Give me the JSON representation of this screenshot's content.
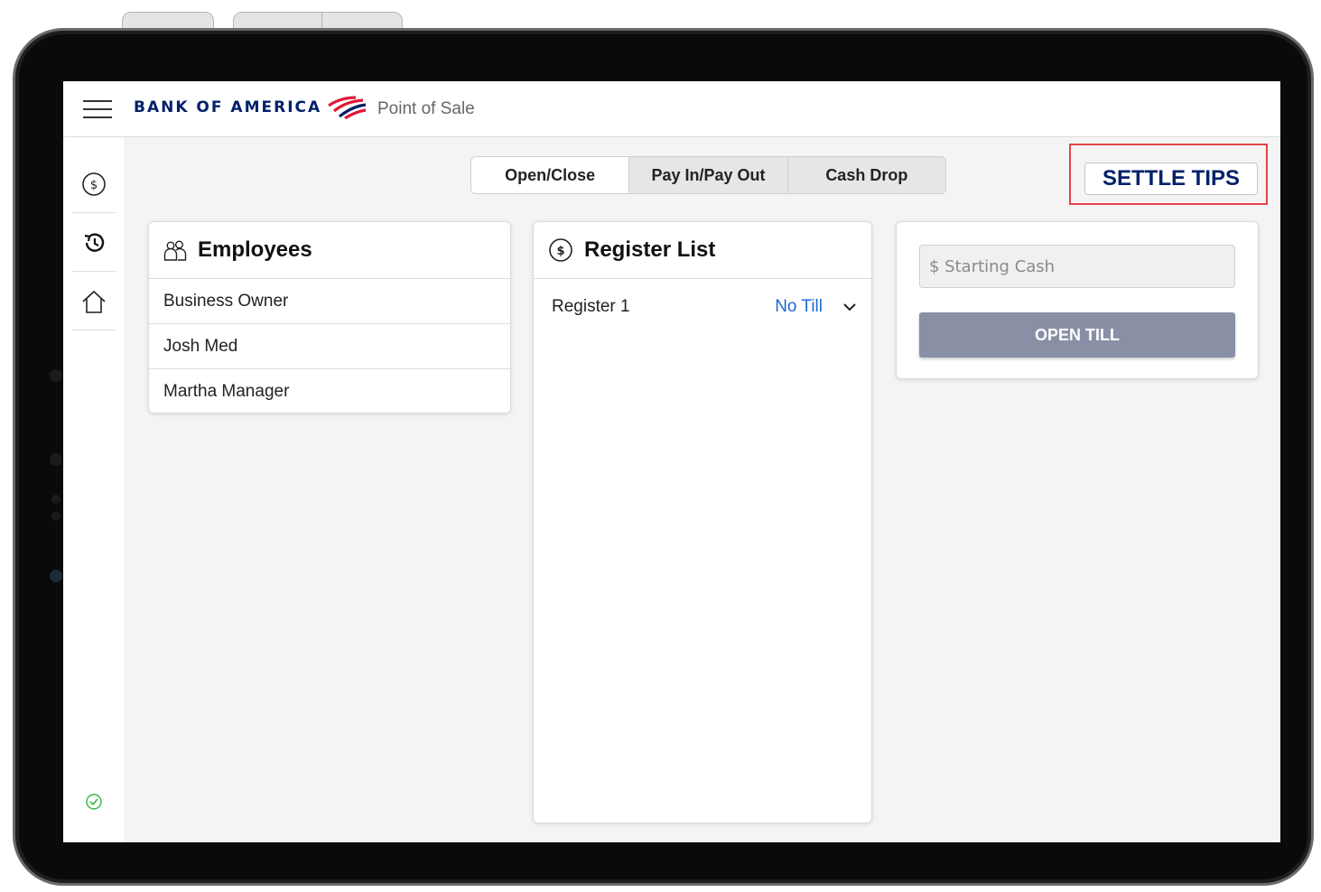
{
  "header": {
    "brand": "BANK OF AMERICA",
    "app_name": "Point of Sale"
  },
  "sidebar": {
    "items": [
      {
        "icon": "dollar-circle-icon"
      },
      {
        "icon": "history-icon"
      },
      {
        "icon": "home-icon"
      }
    ],
    "status_icon": "check-circle-icon"
  },
  "tabs": [
    {
      "label": "Open/Close",
      "active": true
    },
    {
      "label": "Pay In/Pay Out",
      "active": false
    },
    {
      "label": "Cash Drop",
      "active": false
    }
  ],
  "settle_tips": {
    "label": "SETTLE TIPS"
  },
  "employees": {
    "title": "Employees",
    "items": [
      "Business Owner",
      "Josh Med",
      "Martha Manager"
    ]
  },
  "registers": {
    "title": "Register List",
    "items": [
      {
        "name": "Register 1",
        "status": "No Till"
      }
    ]
  },
  "till": {
    "starting_cash_placeholder": "$ Starting Cash",
    "open_label": "OPEN TILL"
  },
  "colors": {
    "brand_navy": "#012169",
    "brand_red": "#e31837",
    "link_blue": "#1d6ad1",
    "button_disabled": "#8990a5",
    "highlight": "#e8434c",
    "success": "#3bb54a"
  }
}
